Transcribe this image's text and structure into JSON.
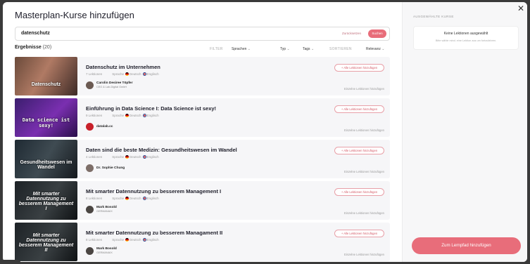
{
  "title": "Masterplan-Kurse hinzufügen",
  "search": {
    "value": "datenschutz",
    "reset": "Zurücksetzen",
    "submit": "Suchen"
  },
  "results": {
    "label": "Ergebnisse",
    "count": "(20)"
  },
  "filters": {
    "filter_label": "FILTER",
    "sort_label": "SORTIEREN",
    "languages": "Sprachen",
    "type": "Typ",
    "tags": "Tags",
    "relevance": "Relevanz"
  },
  "courses": [
    {
      "title": "Datenschutz im Unternehmen",
      "lessons": "7 Lektionen",
      "lang_label": "Sprache",
      "lang1": "Deutsch",
      "lang2": "Englisch",
      "author": "Carolin Desiree Töpfer",
      "author_sub": "CEO & Lab-Digital GmbH",
      "add_all": "+ Alle Lektionen hinzufügen",
      "single": "Einzelne Lektionen hinzufügen",
      "thumb_text": "Datenschutz"
    },
    {
      "title": "Einführung in Data Science I: Data Science ist sexy!",
      "lessons": "9 Lektionen",
      "lang_label": "Sprache",
      "lang1": "Deutsch",
      "lang2": "Englisch",
      "author": "datalab.cc",
      "author_sub": "",
      "add_all": "+ Alle Lektionen hinzufügen",
      "single": "Einzelne Lektionen hinzufügen",
      "thumb_text": "Data science ist sexy!"
    },
    {
      "title": "Daten sind die beste Medizin: Gesundheitswesen im Wandel",
      "lessons": "4 Lektionen",
      "lang_label": "Sprache",
      "lang1": "Deutsch",
      "lang2": "Englisch",
      "author": "Dr. Sophie Chung",
      "author_sub": "",
      "add_all": "+ Alle Lektionen hinzufügen",
      "single": "Einzelne Lektionen hinzufügen",
      "thumb_text": "Gesundheitswesen im Wandel"
    },
    {
      "title": "Mit smarter Datennutzung zu besserem Management I",
      "lessons": "8 Lektionen",
      "lang_label": "Sprache",
      "lang1": "Deutsch",
      "lang2": "Englisch",
      "author": "Mark Bosold",
      "author_sub": "GERMANAIX",
      "add_all": "+ Alle Lektionen hinzufügen",
      "single": "Einzelne Lektionen hinzufügen",
      "thumb_text": "Mit smarter Datennutzung zu besserem Management I"
    },
    {
      "title": "Mit smarter Datennutzung zu besserem Managament II",
      "lessons": "8 Lektionen",
      "lang_label": "Sprache",
      "lang1": "Deutsch",
      "lang2": "Englisch",
      "author": "Mark Bosold",
      "author_sub": "GERMANAIX",
      "add_all": "+ Alle Lektionen hinzufügen",
      "single": "Einzelne Lektionen hinzufügen",
      "thumb_text": "Mit smarter Datennutzung zu besserem Management II"
    }
  ],
  "sidebar": {
    "heading": "AUSGEWÄHLTE KURSE",
    "empty_title": "Keine Lektionen ausgewählt",
    "empty_hint": "Bitte wähle mind. eine Lektion aus um fortzufahren.",
    "add_button": "Zum Lernpfad hinzufügen"
  },
  "colors": {
    "accent": "#e86d7a"
  }
}
